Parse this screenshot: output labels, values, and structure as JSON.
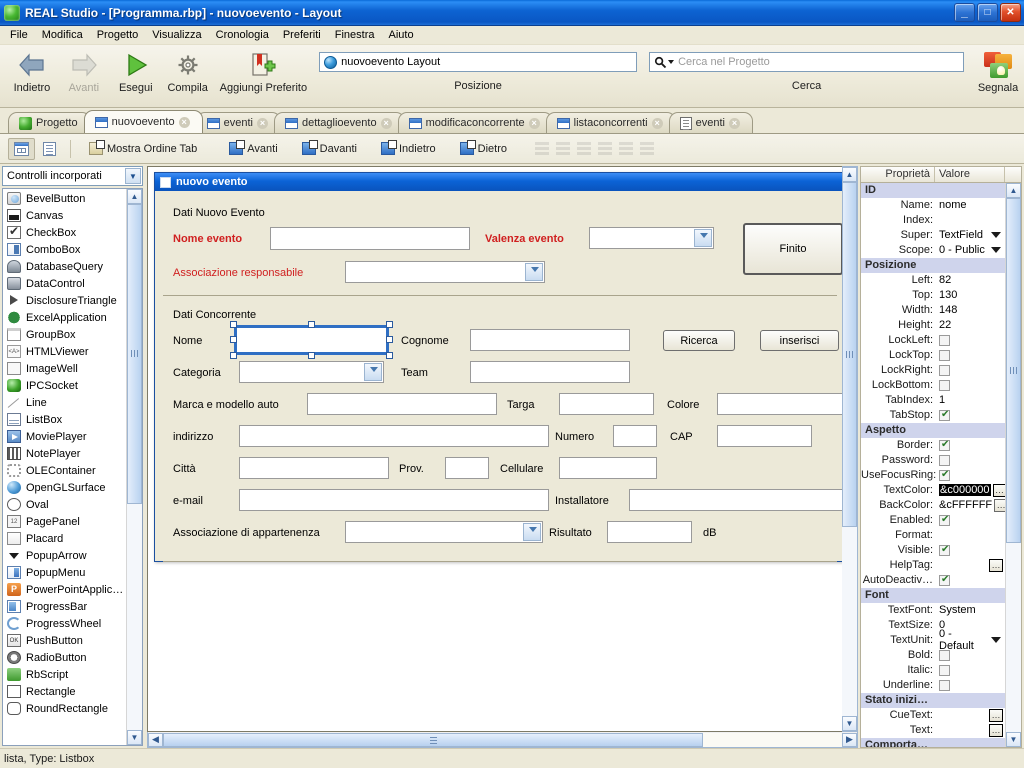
{
  "window": {
    "title": "REAL Studio - [Programma.rbp] - nuovoevento - Layout",
    "icon": "cube-icon",
    "buttons": {
      "minimize": "_",
      "maximize": "□",
      "close": "✕"
    }
  },
  "menubar": {
    "items": [
      "File",
      "Modifica",
      "Progetto",
      "Visualizza",
      "Cronologia",
      "Preferiti",
      "Finestra",
      "Aiuto"
    ]
  },
  "toolbar": {
    "buttons": [
      {
        "label": "Indietro",
        "icon": "arrow-left-icon",
        "enabled": true
      },
      {
        "label": "Avanti",
        "icon": "arrow-right-icon",
        "enabled": false
      },
      {
        "label": "Esegui",
        "icon": "play-icon",
        "enabled": true
      },
      {
        "label": "Compila",
        "icon": "gear-icon",
        "enabled": true
      },
      {
        "label": "Aggiungi Preferito",
        "icon": "bookmark-plus-icon",
        "enabled": true
      }
    ],
    "position_field": {
      "value": "nuovoevento Layout",
      "group_label": "Posizione",
      "icon": "globe-icon"
    },
    "search_field": {
      "placeholder": "Cerca nel Progetto",
      "group_label": "Cerca",
      "icon": "search-icon"
    },
    "report_button": {
      "label": "Segnala",
      "icon": "speech-bubbles-icon"
    }
  },
  "tabs": [
    {
      "label": "Progetto",
      "icon": "project-cube-icon",
      "closable": false,
      "active": false
    },
    {
      "label": "nuovoevento",
      "icon": "window-icon",
      "closable": true,
      "active": true
    },
    {
      "label": "eventi",
      "icon": "window-icon",
      "closable": true,
      "active": false
    },
    {
      "label": "dettaglioevento",
      "icon": "window-icon",
      "closable": true,
      "active": false
    },
    {
      "label": "modificaconcorrente",
      "icon": "window-icon",
      "closable": true,
      "active": false
    },
    {
      "label": "listaconcorrenti",
      "icon": "window-icon",
      "closable": true,
      "active": false
    },
    {
      "label": "eventi",
      "icon": "code-doc-icon",
      "closable": true,
      "active": false
    }
  ],
  "toolbar2": {
    "view_buttons": [
      {
        "name": "layout-view",
        "icon": "layout-grid-icon",
        "pressed": true
      },
      {
        "name": "code-view",
        "icon": "code-doc-icon",
        "pressed": false
      }
    ],
    "buttons": [
      {
        "label": "Mostra Ordine Tab",
        "icon": "tab-order-icon"
      },
      {
        "label": "Avanti",
        "icon": "bring-forward-icon"
      },
      {
        "label": "Davanti",
        "icon": "bring-front-icon"
      },
      {
        "label": "Indietro",
        "icon": "send-backward-icon"
      },
      {
        "label": "Dietro",
        "icon": "send-back-icon"
      }
    ],
    "align_icons": [
      "align-left-icon",
      "align-center-icon",
      "align-right-icon",
      "distribute-h-icon",
      "distribute-v-icon",
      "size-icon"
    ]
  },
  "left_panel": {
    "selector_value": "Controlli incorporati",
    "controls": [
      {
        "label": "BevelButton",
        "icon": "bevelbutton-icon"
      },
      {
        "label": "Canvas",
        "icon": "canvas-icon"
      },
      {
        "label": "CheckBox",
        "icon": "checkbox-icon"
      },
      {
        "label": "ComboBox",
        "icon": "combobox-icon"
      },
      {
        "label": "DatabaseQuery",
        "icon": "databasequery-icon"
      },
      {
        "label": "DataControl",
        "icon": "datacontrol-icon"
      },
      {
        "label": "DisclosureTriangle",
        "icon": "disclosuretriangle-icon"
      },
      {
        "label": "ExcelApplication",
        "icon": "excelapplication-icon"
      },
      {
        "label": "GroupBox",
        "icon": "groupbox-icon"
      },
      {
        "label": "HTMLViewer",
        "icon": "htmlviewer-icon"
      },
      {
        "label": "ImageWell",
        "icon": "imagewell-icon"
      },
      {
        "label": "IPCSocket",
        "icon": "ipcsocket-icon"
      },
      {
        "label": "Line",
        "icon": "line-icon"
      },
      {
        "label": "ListBox",
        "icon": "listbox-icon"
      },
      {
        "label": "MoviePlayer",
        "icon": "movieplayer-icon"
      },
      {
        "label": "NotePlayer",
        "icon": "noteplayer-icon"
      },
      {
        "label": "OLEContainer",
        "icon": "olecontainer-icon"
      },
      {
        "label": "OpenGLSurface",
        "icon": "openglsurface-icon"
      },
      {
        "label": "Oval",
        "icon": "oval-icon"
      },
      {
        "label": "PagePanel",
        "icon": "pagepanel-icon"
      },
      {
        "label": "Placard",
        "icon": "placard-icon"
      },
      {
        "label": "PopupArrow",
        "icon": "popuparrow-icon"
      },
      {
        "label": "PopupMenu",
        "icon": "popupmenu-icon"
      },
      {
        "label": "PowerPointApplic…",
        "icon": "powerpoint-icon"
      },
      {
        "label": "ProgressBar",
        "icon": "progressbar-icon"
      },
      {
        "label": "ProgressWheel",
        "icon": "progresswheel-icon"
      },
      {
        "label": "PushButton",
        "icon": "pushbutton-icon"
      },
      {
        "label": "RadioButton",
        "icon": "radiobutton-icon"
      },
      {
        "label": "RbScript",
        "icon": "rbscript-icon"
      },
      {
        "label": "Rectangle",
        "icon": "rectangle-icon"
      },
      {
        "label": "RoundRectangle",
        "icon": "roundrectangle-icon"
      }
    ]
  },
  "design_window": {
    "title": "nuovo evento",
    "group1_label": "Dati Nuovo Evento",
    "group2_label": "Dati Concorrente",
    "fields": {
      "nome_evento": "Nome evento",
      "valenza_evento": "Valenza evento",
      "associazione_responsabile": "Associazione responsabile",
      "finito_button": "Finito",
      "nome": "Nome",
      "cognome": "Cognome",
      "ricerca_button": "Ricerca",
      "inserisci_button": "inserisci",
      "categoria": "Categoria",
      "team": "Team",
      "marca_modello": "Marca e modello auto",
      "targa": "Targa",
      "colore": "Colore",
      "indirizzo": "indirizzo",
      "numero": "Numero",
      "cap": "CAP",
      "citta": "Città",
      "prov": "Prov.",
      "cellulare": "Cellulare",
      "email": "e-mail",
      "installatore": "Installatore",
      "associazione_appartenenza": "Associazione di appartenenza",
      "risultato": "Risultato",
      "db_unit": "dB"
    }
  },
  "properties": {
    "header": {
      "name_col": "Proprietà",
      "value_col": "Valore"
    },
    "groups": [
      {
        "name": "ID",
        "rows": [
          {
            "label": "Name:",
            "value": "nome",
            "type": "text"
          },
          {
            "label": "Index:",
            "value": "",
            "type": "text"
          },
          {
            "label": "Super:",
            "value": "TextField",
            "type": "dropdown"
          },
          {
            "label": "Scope:",
            "value": "0 - Public",
            "type": "dropdown"
          }
        ]
      },
      {
        "name": "Posizione",
        "rows": [
          {
            "label": "Left:",
            "value": "82",
            "type": "text"
          },
          {
            "label": "Top:",
            "value": "130",
            "type": "text"
          },
          {
            "label": "Width:",
            "value": "148",
            "type": "text"
          },
          {
            "label": "Height:",
            "value": "22",
            "type": "text"
          },
          {
            "label": "LockLeft:",
            "value": false,
            "type": "checkbox"
          },
          {
            "label": "LockTop:",
            "value": false,
            "type": "checkbox"
          },
          {
            "label": "LockRight:",
            "value": false,
            "type": "checkbox"
          },
          {
            "label": "LockBottom:",
            "value": false,
            "type": "checkbox"
          },
          {
            "label": "TabIndex:",
            "value": "1",
            "type": "text"
          },
          {
            "label": "TabStop:",
            "value": true,
            "type": "checkbox"
          }
        ]
      },
      {
        "name": "Aspetto",
        "rows": [
          {
            "label": "Border:",
            "value": true,
            "type": "checkbox"
          },
          {
            "label": "Password:",
            "value": false,
            "type": "checkbox"
          },
          {
            "label": "UseFocusRing:",
            "value": true,
            "type": "checkbox"
          },
          {
            "label": "TextColor:",
            "value": "&c000000",
            "type": "color-selected"
          },
          {
            "label": "BackColor:",
            "value": "&cFFFFFF",
            "type": "color"
          },
          {
            "label": "Enabled:",
            "value": true,
            "type": "checkbox"
          },
          {
            "label": "Format:",
            "value": "",
            "type": "text"
          },
          {
            "label": "Visible:",
            "value": true,
            "type": "checkbox"
          },
          {
            "label": "HelpTag:",
            "value": "",
            "type": "ellipsis"
          },
          {
            "label": "AutoDeactiv…",
            "value": true,
            "type": "checkbox"
          }
        ]
      },
      {
        "name": "Font",
        "rows": [
          {
            "label": "TextFont:",
            "value": "System",
            "type": "text"
          },
          {
            "label": "TextSize:",
            "value": "0",
            "type": "text"
          },
          {
            "label": "TextUnit:",
            "value": "0 - Default",
            "type": "dropdown"
          },
          {
            "label": "Bold:",
            "value": false,
            "type": "checkbox"
          },
          {
            "label": "Italic:",
            "value": false,
            "type": "checkbox"
          },
          {
            "label": "Underline:",
            "value": false,
            "type": "checkbox"
          }
        ]
      },
      {
        "name": "Stato inizi…",
        "rows": [
          {
            "label": "CueText:",
            "value": "",
            "type": "ellipsis"
          },
          {
            "label": "Text:",
            "value": "",
            "type": "ellipsis"
          }
        ]
      },
      {
        "name": "Comporta…",
        "rows": []
      }
    ]
  },
  "statusbar": {
    "text": "lista, Type: Listbox"
  },
  "colors": {
    "titlebar_blue": "#0a63d2",
    "accent_red": "#d02020",
    "panel_bg": "#ece9d8",
    "selection_blue": "#2f6fc4",
    "section_header": "#cfd4ec"
  }
}
